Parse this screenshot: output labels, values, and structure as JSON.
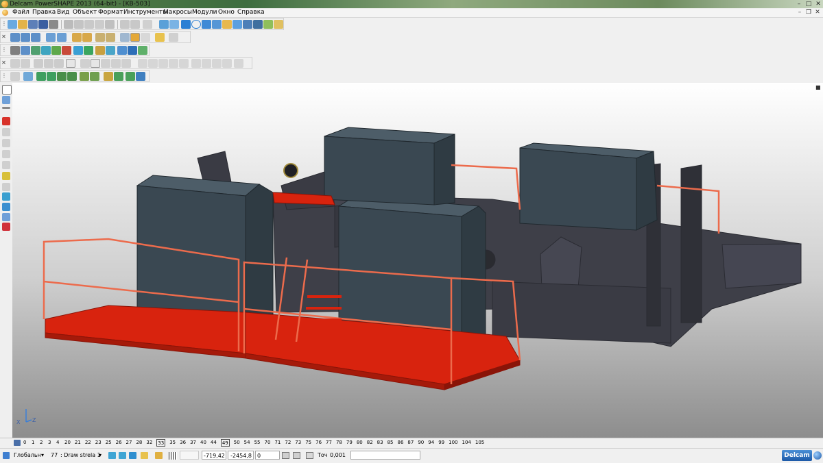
{
  "window": {
    "title": "Delcam PowerSHAPE 2013 (64-bit) - [KB-503]"
  },
  "menu": {
    "items": [
      "Файл",
      "Правка",
      "Вид",
      "Объект",
      "Формат",
      "Инструменты",
      "Макросы",
      "Модули",
      "Окно",
      "Справка"
    ]
  },
  "levels": {
    "items": [
      "0",
      "1",
      "2",
      "3",
      "4",
      "20",
      "21",
      "22",
      "23",
      "25",
      "26",
      "27",
      "28",
      "32",
      "33",
      "35",
      "36",
      "37",
      "40",
      "44",
      "49",
      "50",
      "54",
      "55",
      "70",
      "71",
      "72",
      "73",
      "75",
      "76",
      "77",
      "78",
      "79",
      "80",
      "82",
      "83",
      "85",
      "86",
      "87",
      "90",
      "94",
      "99",
      "100",
      "104",
      "105"
    ],
    "boxed": [
      "33",
      "49"
    ]
  },
  "status": {
    "workplane": "Глобальн",
    "level_num": "77",
    "level_name": ": Draw strela 1",
    "x": "-719,42",
    "y": "-2454,8",
    "z": "0",
    "tol_label": "Точ",
    "tol_value": "0,001"
  },
  "brand": {
    "text": "Delcam"
  },
  "axis": {
    "x": "X",
    "z": "Z"
  },
  "colors": {
    "viewport_top": "#ffffff",
    "viewport_bottom": "#8d8d8d",
    "frame": "#3e3f48",
    "cabinet": "#3a4852",
    "platform": "#d8230e",
    "railing": "#ec6b4c"
  },
  "icons": {
    "title": "powershape-app-icon",
    "viewport": "3d-model-view",
    "brand": "delcam-logo"
  }
}
